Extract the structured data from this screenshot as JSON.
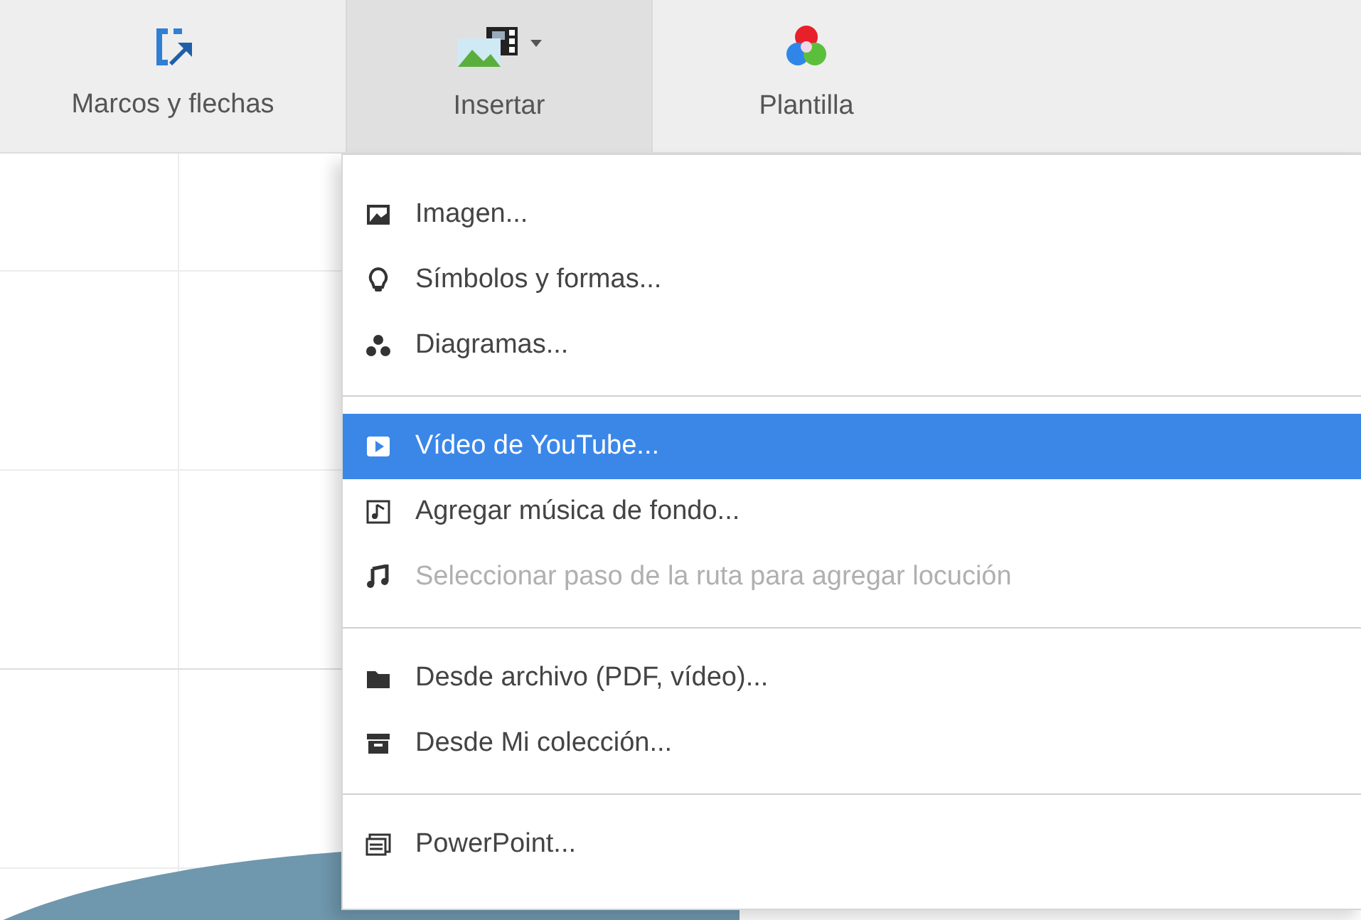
{
  "toolbar": [
    {
      "label": "Marcos y flechas",
      "selected": false
    },
    {
      "label": "Insertar",
      "selected": true
    },
    {
      "label": "Plantilla",
      "selected": false
    }
  ],
  "menu": {
    "items": [
      {
        "kind": "item",
        "label": "Imagen...",
        "selected": false,
        "disabled": false
      },
      {
        "kind": "item",
        "label": "Símbolos y formas...",
        "selected": false,
        "disabled": false
      },
      {
        "kind": "item",
        "label": "Diagramas...",
        "selected": false,
        "disabled": false
      },
      {
        "kind": "separator"
      },
      {
        "kind": "item",
        "label": "Vídeo de YouTube...",
        "selected": true,
        "disabled": false
      },
      {
        "kind": "item",
        "label": "Agregar música de fondo...",
        "selected": false,
        "disabled": false
      },
      {
        "kind": "item",
        "label": "Seleccionar paso de la ruta para agregar locución",
        "selected": false,
        "disabled": true
      },
      {
        "kind": "separator"
      },
      {
        "kind": "item",
        "label": "Desde archivo (PDF, vídeo)...",
        "selected": false,
        "disabled": false
      },
      {
        "kind": "item",
        "label": "Desde Mi colección...",
        "selected": false,
        "disabled": false
      },
      {
        "kind": "separator"
      },
      {
        "kind": "item",
        "label": "PowerPoint...",
        "selected": false,
        "disabled": false
      }
    ]
  }
}
